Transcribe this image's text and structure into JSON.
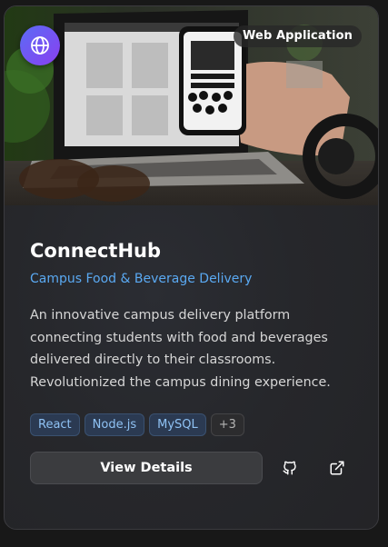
{
  "card": {
    "category_badge": "Web Application",
    "platform_icon": "globe-icon",
    "title": "ConnectHub",
    "subtitle": "Campus Food & Beverage Delivery",
    "description": "An innovative campus delivery platform connecting students with food and beverages delivered directly to their classrooms. Revolutionized the campus dining experience.",
    "tags": [
      "React",
      "Node.js",
      "MySQL"
    ],
    "more_tags": "+3",
    "view_button": "View Details",
    "github_icon": "github-icon",
    "external_icon": "external-link-icon"
  },
  "colors": {
    "accent": "#5aa9f2",
    "badge_gradient_start": "#5b6cf5",
    "badge_gradient_end": "#8a3ff0",
    "tag_text": "#8fc2f4"
  }
}
